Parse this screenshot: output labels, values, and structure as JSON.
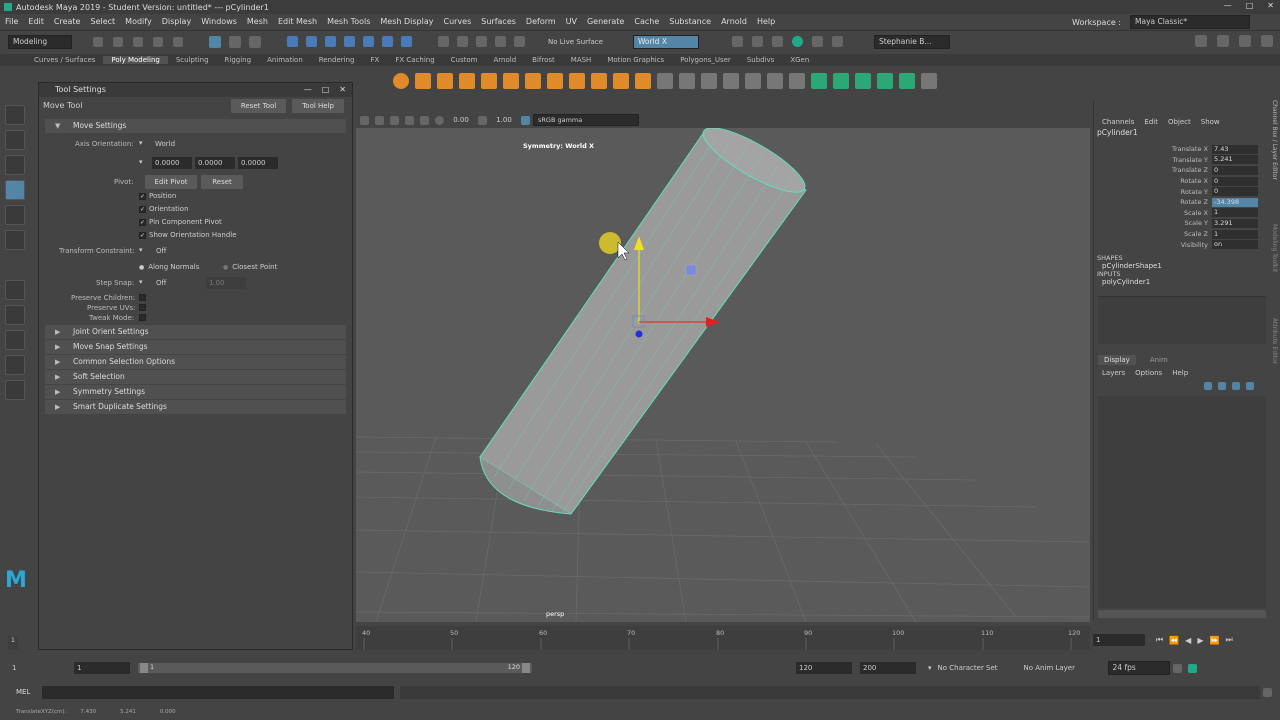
{
  "window": {
    "title": "Autodesk Maya 2019 - Student Version: untitled*   ---   pCylinder1"
  },
  "menus": [
    "File",
    "Edit",
    "Create",
    "Select",
    "Modify",
    "Display",
    "Windows",
    "Mesh",
    "Edit Mesh",
    "Mesh Tools",
    "Mesh Display",
    "Curves",
    "Surfaces",
    "Deform",
    "UV",
    "Generate",
    "Cache",
    "Substance",
    "Arnold",
    "Help"
  ],
  "workspace": {
    "label": "Workspace :",
    "value": "Maya Classic*"
  },
  "status": {
    "menuset": "Modeling",
    "live_surface": "No Live Surface",
    "symmetry": "World X",
    "user": "Stephanie B..."
  },
  "shelf_tabs": [
    "Curves / Surfaces",
    "Poly Modeling",
    "Sculpting",
    "Rigging",
    "Animation",
    "Rendering",
    "FX",
    "FX Caching",
    "Custom",
    "Arnold",
    "Bifrost",
    "MASH",
    "Motion Graphics",
    "Polygons_User",
    "Subdivs",
    "XGen"
  ],
  "shelf_active": "Poly Modeling",
  "tool_settings": {
    "window_title": "Tool Settings",
    "tool_name": "Move Tool",
    "reset_tool": "Reset Tool",
    "tool_help": "Tool Help",
    "move_settings": "Move Settings",
    "axis_orientation_label": "Axis Orientation:",
    "axis_orientation_value": "World",
    "coords": [
      "0.0000",
      "0.0000",
      "0.0000"
    ],
    "pivot_label": "Pivot:",
    "edit_pivot": "Edit Pivot",
    "reset": "Reset",
    "checks": [
      "Position",
      "Orientation",
      "Pin Component Pivot",
      "Show Orientation Handle"
    ],
    "transform_constraint_label": "Transform Constraint:",
    "transform_constraint_value": "Off",
    "along_normals": "Along Normals",
    "closest_point": "Closest Point",
    "step_snap_label": "Step Snap:",
    "step_snap_value": "Off",
    "step_snap_num": "1.00",
    "preserve_children": "Preserve Children:",
    "preserve_uvs": "Preserve UVs:",
    "tweak_mode": "Tweak Mode:",
    "sections": [
      "Joint Orient Settings",
      "Move Snap Settings",
      "Common Selection Options",
      "Soft Selection",
      "Symmetry Settings",
      "Smart Duplicate Settings"
    ]
  },
  "viewport": {
    "exposure": "0.00",
    "gamma": "1.00",
    "colorspace": "sRGB gamma",
    "symmetry_label": "Symmetry: World X",
    "camera": "persp"
  },
  "channel_box": {
    "tabs": [
      "Channels",
      "Edit",
      "Object",
      "Show"
    ],
    "object": "pCylinder1",
    "attrs": [
      {
        "name": "Translate X",
        "value": "7.43"
      },
      {
        "name": "Translate Y",
        "value": "5.241"
      },
      {
        "name": "Translate Z",
        "value": "0"
      },
      {
        "name": "Rotate X",
        "value": "0"
      },
      {
        "name": "Rotate Y",
        "value": "0"
      },
      {
        "name": "Rotate Z",
        "value": "-34.398"
      },
      {
        "name": "Scale X",
        "value": "1"
      },
      {
        "name": "Scale Y",
        "value": "3.291"
      },
      {
        "name": "Scale Z",
        "value": "1"
      },
      {
        "name": "Visibility",
        "value": "on"
      }
    ],
    "shapes_label": "SHAPES",
    "shape": "pCylinderShape1",
    "inputs_label": "INPUTS",
    "input": "polyCylinder1",
    "layer_tabs": [
      "Display",
      "Anim"
    ],
    "layer_menu": [
      "Layers",
      "Options",
      "Help"
    ],
    "side_tabs": [
      "Channel Box / Layer Editor",
      "Modeling Toolkit",
      "Attribute Editor"
    ]
  },
  "timeline": {
    "ticks": [
      "40",
      "50",
      "60",
      "70",
      "80",
      "90",
      "100",
      "110",
      "120"
    ],
    "current": "1"
  },
  "range": {
    "start": "1",
    "inner_start": "1",
    "marker": "1",
    "inner_end": "120",
    "end": "120",
    "anim_end": "200",
    "char_set": "No Character Set",
    "anim_layer": "No Anim Layer",
    "fps": "24 fps"
  },
  "cmd": {
    "lang": "MEL"
  },
  "help": {
    "text": "TranslateXYZ(cm):",
    "x": "7.430",
    "y": "5.241",
    "z": "0.000"
  },
  "colors": {
    "accent": "#5285a6",
    "wire": "#5ee0c0",
    "bg": "#444444"
  }
}
